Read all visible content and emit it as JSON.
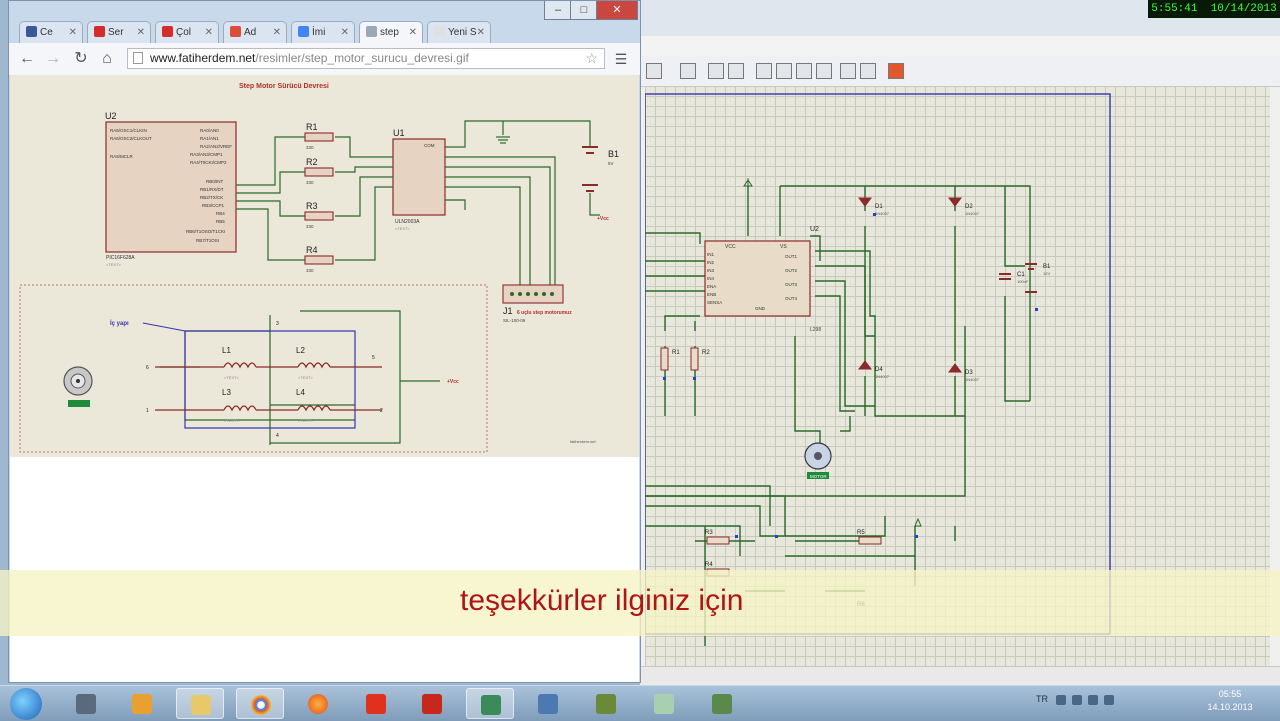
{
  "recorder_clock": {
    "time": "5:55:41",
    "date": "10/14/2013"
  },
  "browser": {
    "tabs": [
      {
        "label": "Ce",
        "icon": "facebook-icon",
        "color": "#3b5998"
      },
      {
        "label": "Ser",
        "icon": "youtube-icon",
        "color": "#d42b2b"
      },
      {
        "label": "Çol",
        "icon": "youtube-icon",
        "color": "#d42b2b"
      },
      {
        "label": "Ad",
        "icon": "google-plus-icon",
        "color": "#dd4b39"
      },
      {
        "label": "İmi",
        "icon": "google-icon",
        "color": "#4285f4"
      },
      {
        "label": "step",
        "icon": "page-icon",
        "color": "#9aa8b8",
        "active": true
      },
      {
        "label": "Yeni S",
        "icon": "new-tab-icon",
        "color": "#e0e0e0"
      }
    ],
    "url_host": "www.fatiherdem.net",
    "url_path": "/resimler/step_motor_surucu_devresi.gif"
  },
  "schematic_image": {
    "title": "Step Motor Sürücü Devresi",
    "u2_label": "U2",
    "u2_name": "PIC16F628A",
    "u2_pins_left": [
      "RA5/OSC1/CLKIN",
      "RA6/OSC2/CLKOUT",
      "RA3/AN3/CMP1",
      "RA5/MCLR"
    ],
    "u2_pins_right": [
      "RA0/AN0",
      "RA1/AN1",
      "RA2/AN2/VREF",
      "RA3/AN3/CMP1",
      "RA4/T0CKI/CMP2",
      "RB0/INT",
      "RB1/RX/DT",
      "RB2/TX/CK",
      "RB3/CCP1",
      "RB4",
      "RB5",
      "RB6/T1OSO/T1CKI",
      "RB7/T1OSI"
    ],
    "u1_label": "U1",
    "u1_name": "ULN2003A",
    "u1_com": "COM",
    "resistors": [
      "R1",
      "R2",
      "R3",
      "R4"
    ],
    "resistor_value": "330",
    "battery_label": "B1",
    "battery_value": "5V",
    "vcc_label": "+Vcc",
    "text_placeholder": "<TEXT>",
    "j1_label": "J1",
    "j1_desc": "6 uçlu step motorumuz",
    "j1_part": "SIL-100-06",
    "inner_label": "İç yapı",
    "coils": [
      "L1",
      "L2",
      "L3",
      "L4"
    ],
    "pin_numbers": [
      "3",
      "5",
      "6",
      "1",
      "2",
      "4"
    ],
    "watermark": "fatiherdem.net"
  },
  "proteus": {
    "u2_label": "U2",
    "u2_name": "L298",
    "u2_pins_in": [
      "IN1",
      "IN2",
      "IN3",
      "IN4",
      "ENA",
      "ENB",
      "SENSA",
      "SENSB"
    ],
    "u2_pins_out": [
      "OUT1",
      "OUT2",
      "OUT3",
      "OUT4"
    ],
    "u2_top_pins": [
      "VCC",
      "VS"
    ],
    "u2_gnd": "GND",
    "diodes": [
      "D1",
      "D2",
      "D3",
      "D4"
    ],
    "diode_part": "1N4007",
    "cap_label": "C1",
    "cap_value": "100nF",
    "batt_label": "B1",
    "batt_value": "12V",
    "resistors": [
      "R1",
      "R2",
      "R3",
      "R4",
      "R5",
      "R6"
    ],
    "motor_label": "MOTOR"
  },
  "subtitle": "teşekkürler  ilginiz için",
  "taskbar": {
    "apps": [
      "start",
      "media-player",
      "media-center",
      "explorer",
      "chrome",
      "firefox",
      "youtube",
      "pdf",
      "proteus-isis",
      "ares",
      "circuit",
      "notepad",
      "tools"
    ],
    "tray_lang": "TR",
    "clock_time": "05:55",
    "clock_date": "14.10.2013"
  }
}
